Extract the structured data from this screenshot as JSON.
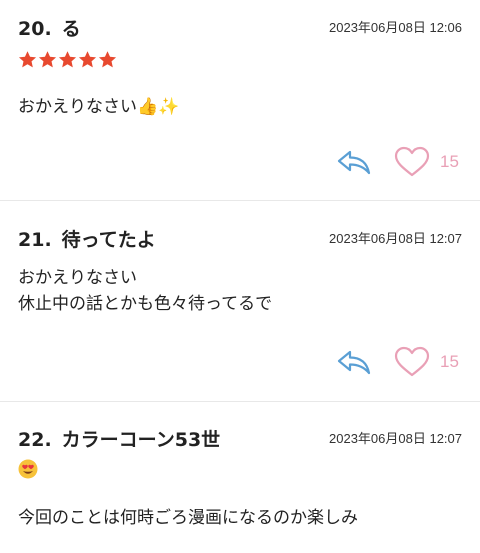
{
  "comments": [
    {
      "number": "20.",
      "name": "る",
      "date": "2023年06月08日 12:06",
      "rating": 5,
      "lines": [
        "おかえりなさい"
      ],
      "emoji_inline": "👍✨",
      "likes": "15"
    },
    {
      "number": "21.",
      "name": "待ってたよ",
      "date": "2023年06月08日 12:07",
      "lines": [
        "おかえりなさい",
        "休止中の話とかも色々待ってるで"
      ],
      "likes": "15"
    },
    {
      "number": "22.",
      "name": "カラーコーン53世",
      "date": "2023年06月08日 12:07",
      "emoji": "heart-eyes-emoji",
      "lines": [
        "今回のことは何時ごろ漫画になるのか楽しみ"
      ]
    }
  ],
  "colors": {
    "star": "#e8492f",
    "reply": "#5a9fd4",
    "heart": "#e9a0b6"
  },
  "icons": [
    "star-icon",
    "reply-icon",
    "heart-icon",
    "heart-eyes-emoji"
  ]
}
